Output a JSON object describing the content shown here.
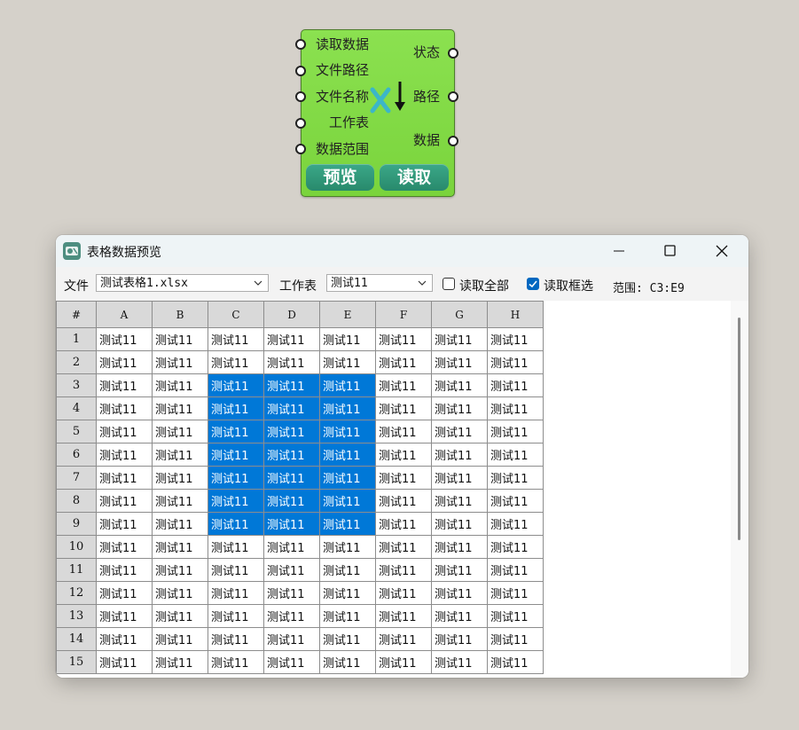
{
  "component": {
    "inputs": [
      "读取数据",
      "文件路径",
      "文件名称",
      "工作表",
      "数据范围"
    ],
    "outputs": [
      "状态",
      "路径",
      "数据"
    ],
    "icon": "x-arrow-icon",
    "buttons": {
      "preview": "预览",
      "read": "读取"
    }
  },
  "window": {
    "title": "表格数据预览",
    "app_icon": "spreadsheet-app-icon",
    "controls": {
      "minimize": "minimize-icon",
      "maximize": "maximize-icon",
      "close": "close-icon"
    }
  },
  "toolbar": {
    "file_label": "文件",
    "file_value": "测试表格1.xlsx",
    "sheet_label": "工作表",
    "sheet_value": "测试11",
    "read_all_label": "读取全部",
    "read_all_checked": false,
    "read_selection_label": "读取框选",
    "read_selection_checked": true,
    "range_text": "范围: C3:E9"
  },
  "grid": {
    "corner": "#",
    "columns": [
      "A",
      "B",
      "C",
      "D",
      "E",
      "F",
      "G",
      "H"
    ],
    "rows": [
      "1",
      "2",
      "3",
      "4",
      "5",
      "6",
      "7",
      "8",
      "9",
      "10",
      "11",
      "12",
      "13",
      "14",
      "15"
    ],
    "cell_value": "测试11",
    "selection": {
      "from_row": 3,
      "to_row": 9,
      "from_col": "C",
      "to_col": "E"
    }
  },
  "colors": {
    "component_green": "#7ad43c",
    "button_teal": "#2f9a7a",
    "selection_blue": "#0078d7",
    "checkbox_blue": "#0067c0"
  }
}
